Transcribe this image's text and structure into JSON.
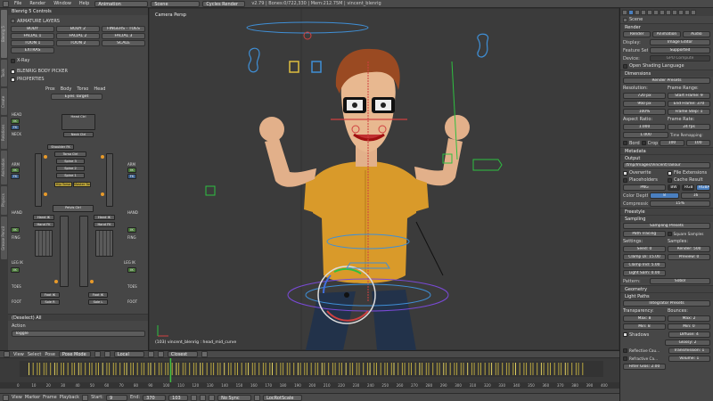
{
  "topbar": {
    "menus": [
      "File",
      "Render",
      "Window",
      "Help"
    ],
    "workspace": "Animation",
    "scene": "Scene",
    "engine": "Cycles Render",
    "stats": "v2.79 | Bones:0/722,330 | Mem:212.75M | vincent_blenrig"
  },
  "left_panel": {
    "tabs": [
      "Blenrig 5",
      "Tools",
      "Create",
      "Relations",
      "Animation",
      "Physics",
      "Grease Pencil"
    ],
    "title": "Blenrig 5 Controls",
    "armature_layers_label": "ARMATURE LAYERS",
    "layer_buttons": [
      [
        "BODY",
        "BODY 2",
        "FINGERS - TOES"
      ],
      [
        "FACIAL 1",
        "FACIAL 2",
        "FACIAL 3"
      ],
      [
        "TOON 1",
        "TOON 2",
        "SCALE"
      ],
      [
        "EXTRAS"
      ]
    ],
    "xray_label": "X-Ray",
    "body_picker_label": "BLENRIG BODY PICKER",
    "properties_label": "PROPERTIES",
    "picker_headers": [
      "Prox",
      "Body",
      "Torso",
      "Head"
    ],
    "eyes_target": "Eyes Target",
    "picker_labels": {
      "head": "HEAD",
      "neck": "NECK",
      "arm_l": "ARM",
      "arm_r": "ARM",
      "hand_l": "HAND",
      "hand_r": "HAND",
      "fing_l": "FING",
      "fing_r": "FING",
      "leg_l": "LEG IK",
      "leg_r": "LEG IK",
      "toes_l": "TOES",
      "toes_r": "TOES",
      "foot_l": "FOOT",
      "foot_r": "FOOT",
      "ik": "IK",
      "fk": "FK",
      "ik_fk": "IK FK"
    },
    "picker_buttons": {
      "head_ctrl": "Head Ctrl",
      "neck_ctrl": "Neck Ctrl",
      "shoulder_fk": "Shoulder FK",
      "torso_ctrl": "Torso Ctrl",
      "spine3": "Spine 3",
      "spine2": "Spine 2",
      "spine1": "Spine 1",
      "pelvis_ctrl": "Pelvis Ctrl",
      "hand_ik_l": "Hand IK",
      "hand_ik_r": "Hand IK",
      "hand_fk_l": "Hand FK",
      "hand_fk_r": "Hand FK",
      "foot_ik_l": "Foot IK",
      "foot_ik_r": "Foot IK",
      "sole_l": "Sole R",
      "sole_r": "Sole L",
      "hip_torso": "Hip Torso",
      "master_torso": "Master Torso"
    },
    "operator_header": "(Deselect) All",
    "action_label": "Action",
    "action_value": "Toggle"
  },
  "viewport": {
    "camera_label": "Camera Persp",
    "status": "(103) vincent_blenrig : head_mid_curve"
  },
  "right_panel": {
    "scene_label": "Scene",
    "render_section": "Render",
    "render_buttons": [
      "Render",
      "Animation",
      "Audio"
    ],
    "display_label": "Display:",
    "display_value": "Image Editor",
    "feature_label": "Feature Set:",
    "feature_value": "Supported",
    "device_label": "Device:",
    "device_value": "GPU Compute",
    "osl_label": "Open Shading Language",
    "dimensions_section": "Dimensions",
    "render_presets": "Render Presets",
    "resolution_label": "Resolution:",
    "frame_range_label": "Frame Range:",
    "res_x": "720 px",
    "res_y": "960 px",
    "res_pct": "100%",
    "start_frame": "Start Frame: 9",
    "end_frame": "End Frame: 370",
    "frame_step": "Frame Step: 1",
    "aspect_label": "Aspect Ratio:",
    "frame_rate_label": "Frame Rate:",
    "aspect_x": "1.000",
    "aspect_y": "1.000",
    "fps": "24 fps",
    "time_remap_label": "Time Remapping:",
    "remap_old": "100",
    "remap_new": "100",
    "border_label": "Bord",
    "crop_label": "Crop",
    "metadata_section": "Metadata",
    "output_section": "Output",
    "output_path": "/tmp/Images/Vincent/Tailour",
    "overwrite_label": "Overwrite",
    "file_ext_label": "File Extensions",
    "placeholders_label": "Placeholders",
    "cache_label": "Cache Result",
    "format_value": "PNG",
    "bw_label": "BW",
    "rgb_label": "RGB",
    "rgba_label": "RGBA",
    "color_depth_label": "Color Depth:",
    "depth8": "8",
    "depth16": "16",
    "compression": "Compression:",
    "compression_value": "15%",
    "freestyle_section": "Freestyle",
    "sampling_section": "Sampling",
    "sampling_presets": "Sampling Presets",
    "path_tracing": "Path Tracing",
    "square_samples": "Square Samples",
    "settings_label": "Settings:",
    "samples_label": "Samples:",
    "seed": "Seed: 0",
    "clamp_direct": "Clamp Di: 15.00",
    "clamp_indirect": "Clamp Ind: 5.00",
    "light_sampling": "Light Sam: 0.00",
    "render_samples": "Render: 500",
    "preview_samples": "Preview: 0",
    "pattern_label": "Pattern:",
    "pattern_value": "Sobol",
    "geometry_section": "Geometry",
    "light_paths_section": "Light Paths",
    "integrator_presets": "Integrator Presets",
    "transparency_label": "Transparency:",
    "bounces_label": "Bounces:",
    "trans_max": "Max: 8",
    "trans_min": "Min: 8",
    "bounce_max": "Max: 2",
    "bounce_min": "Min: 0",
    "shadows_label": "Shadows",
    "diffuse": "Diffuse: 4",
    "glossy": "Glossy: 2",
    "transmission": "Transmission: 1",
    "volume": "Volume: 1",
    "reflective_caustics": "Reflective Cau...",
    "refractive_caustics": "Refractive Ca...",
    "filter_glossy": "Filter Glos: 2.00"
  },
  "timeline": {
    "menus": [
      "View",
      "Select",
      "Pose"
    ],
    "mode": "Pose Mode",
    "pivot": "Local",
    "layer": "Closest",
    "frame_ticks": [
      "0",
      "10",
      "20",
      "30",
      "40",
      "50",
      "60",
      "70",
      "80",
      "90",
      "100",
      "110",
      "120",
      "130",
      "140",
      "150",
      "160",
      "170",
      "180",
      "190",
      "200",
      "210",
      "220",
      "230",
      "240",
      "250",
      "260",
      "270",
      "280",
      "290",
      "300",
      "310",
      "320",
      "330",
      "340",
      "350",
      "360",
      "370",
      "380",
      "390",
      "400"
    ],
    "playbar_menus": [
      "View",
      "Marker",
      "Frame",
      "Playback"
    ],
    "start": "Start:",
    "start_value": "9",
    "end": "End:",
    "end_value": "370",
    "current": "103",
    "sync": "No Sync",
    "keying": "LocRotScale"
  }
}
